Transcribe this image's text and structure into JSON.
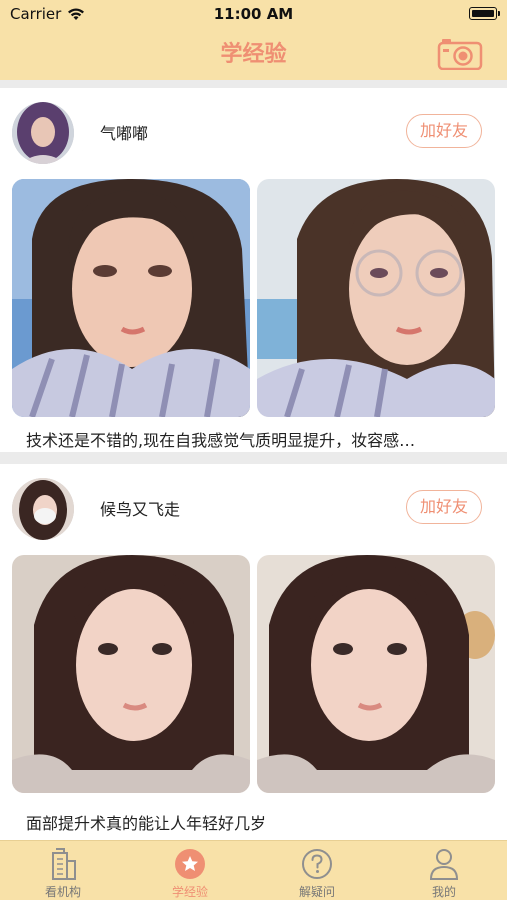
{
  "status_bar": {
    "carrier": "Carrier",
    "time": "11:00 AM"
  },
  "nav": {
    "title": "学经验",
    "camera_icon": "camera-icon"
  },
  "posts": [
    {
      "username": "气嘟嘟",
      "add_friend_label": "加好友",
      "caption": "技术还是不错的,现在自我感觉气质明显提升，妆容感…"
    },
    {
      "username": "候鸟又飞走",
      "add_friend_label": "加好友",
      "caption": "面部提升术真的能让人年轻好几岁"
    }
  ],
  "tabs": [
    {
      "label": "看机构",
      "icon": "building-icon",
      "active": false
    },
    {
      "label": "学经验",
      "icon": "star-icon",
      "active": true
    },
    {
      "label": "解疑问",
      "icon": "question-icon",
      "active": false
    },
    {
      "label": "我的",
      "icon": "person-icon",
      "active": false
    }
  ],
  "colors": {
    "header_bg": "#f8e1a8",
    "accent": "#ef8f73",
    "accent_border": "#f1b49b",
    "separator": "#ebebeb"
  }
}
